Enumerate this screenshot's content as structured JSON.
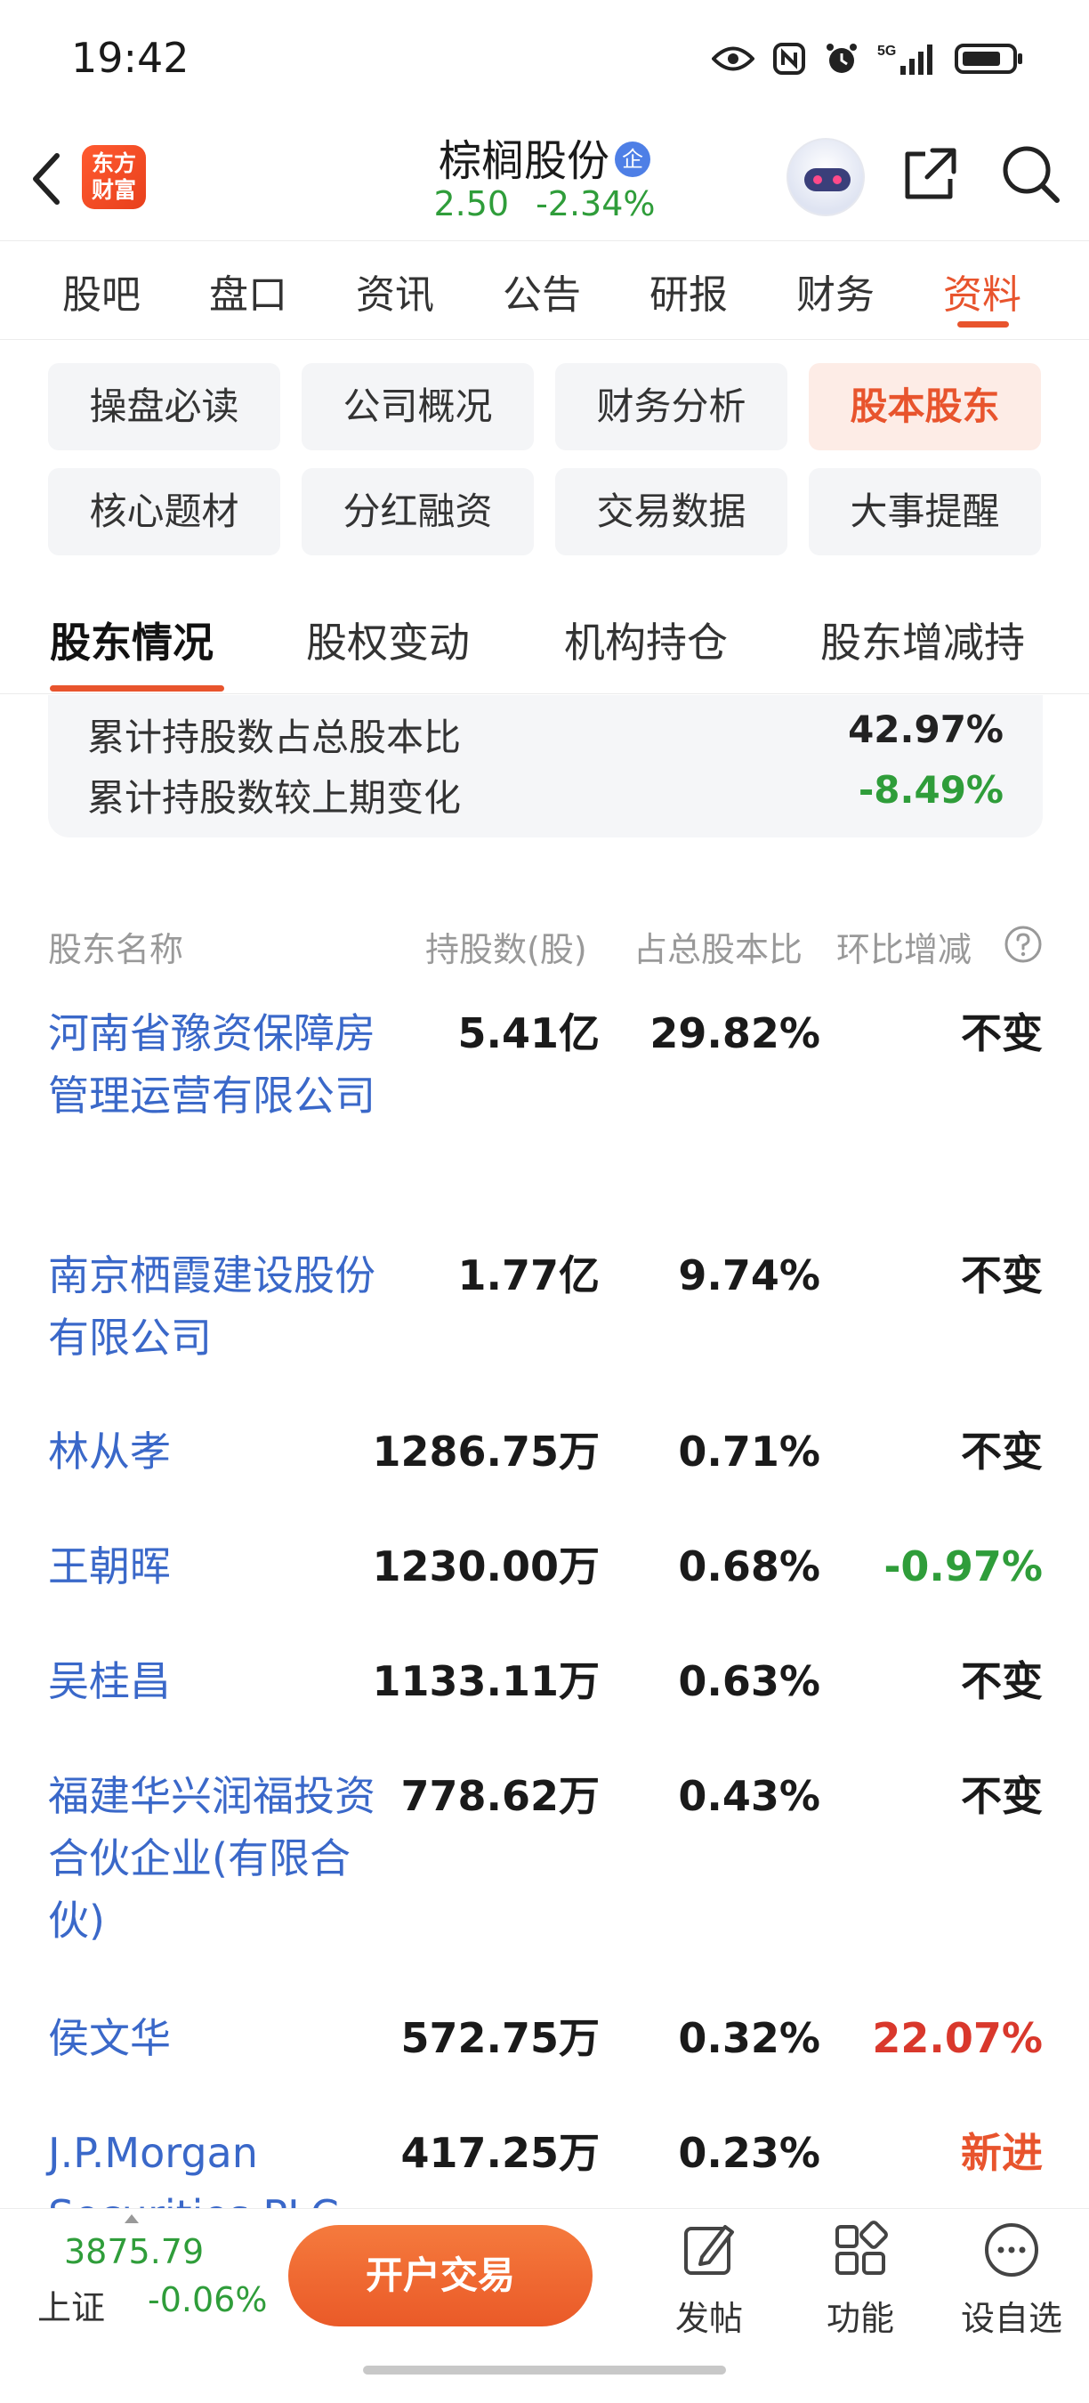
{
  "status_bar": {
    "time": "19:42",
    "network": "5G"
  },
  "header": {
    "logo_text": "东方\n财富",
    "logo_line1": "东方",
    "logo_line2": "财富",
    "stock_name": "棕榈股份",
    "badge": "企",
    "price": "2.50",
    "change_pct": "-2.34%"
  },
  "main_tabs": [
    "股吧",
    "盘口",
    "资讯",
    "公告",
    "研报",
    "财务",
    "资料"
  ],
  "main_tab_active": "资料",
  "sub_sections": [
    "操盘必读",
    "公司概况",
    "财务分析",
    "股本股东",
    "核心题材",
    "分红融资",
    "交易数据",
    "大事提醒"
  ],
  "sub_section_active": "股本股东",
  "shareholder_tabs": [
    "股东情况",
    "股权变动",
    "机构持仓",
    "股东增减持"
  ],
  "shareholder_tab_active": "股东情况",
  "summary": {
    "rows": [
      {
        "label": "累计持股数占总股本比",
        "value": "42.97%"
      },
      {
        "label": "累计持股数较上期变化",
        "value": "-8.49%"
      }
    ]
  },
  "table": {
    "headers": [
      "股东名称",
      "持股数(股)",
      "占总股本比",
      "环比增减"
    ],
    "rows": [
      {
        "name": "河南省豫资保障房管理运营有限公司",
        "shares": "5.41亿",
        "ratio": "29.82%",
        "change": "不变",
        "change_color": "#1a1a1a"
      },
      {
        "name": "南京栖霞建设股份有限公司",
        "shares": "1.77亿",
        "ratio": "9.74%",
        "change": "不变",
        "change_color": "#1a1a1a"
      },
      {
        "name": "林从孝",
        "shares": "1286.75万",
        "ratio": "0.71%",
        "change": "不变",
        "change_color": "#1a1a1a"
      },
      {
        "name": "王朝晖",
        "shares": "1230.00万",
        "ratio": "0.68%",
        "change": "-0.97%",
        "change_color": "#2f9d3a"
      },
      {
        "name": "吴桂昌",
        "shares": "1133.11万",
        "ratio": "0.63%",
        "change": "不变",
        "change_color": "#1a1a1a"
      },
      {
        "name": "福建华兴润福投资合伙企业(有限合伙)",
        "shares": "778.62万",
        "ratio": "0.43%",
        "change": "不变",
        "change_color": "#1a1a1a"
      },
      {
        "name": "侯文华",
        "shares": "572.75万",
        "ratio": "0.32%",
        "change": "22.07%",
        "change_color": "#d9382c"
      },
      {
        "name": "J.P.Morgan Securities PLC-自",
        "shares": "417.25万",
        "ratio": "0.23%",
        "change": "新进",
        "change_color": "#e8542d"
      }
    ]
  },
  "bottom_bar": {
    "index_value": "3875.79",
    "index_name": "上证",
    "index_change": "-0.06%",
    "trade_button": "开户交易",
    "actions": [
      {
        "label": "发帖",
        "icon": "edit-icon"
      },
      {
        "label": "功能",
        "icon": "apps-grid-icon"
      },
      {
        "label": "设自选",
        "icon": "more-circle-icon"
      }
    ]
  },
  "colors": {
    "accent": "#e8542d",
    "up_red": "#d9382c",
    "down_green": "#2f9d3a",
    "link_blue": "#3a68c9"
  }
}
